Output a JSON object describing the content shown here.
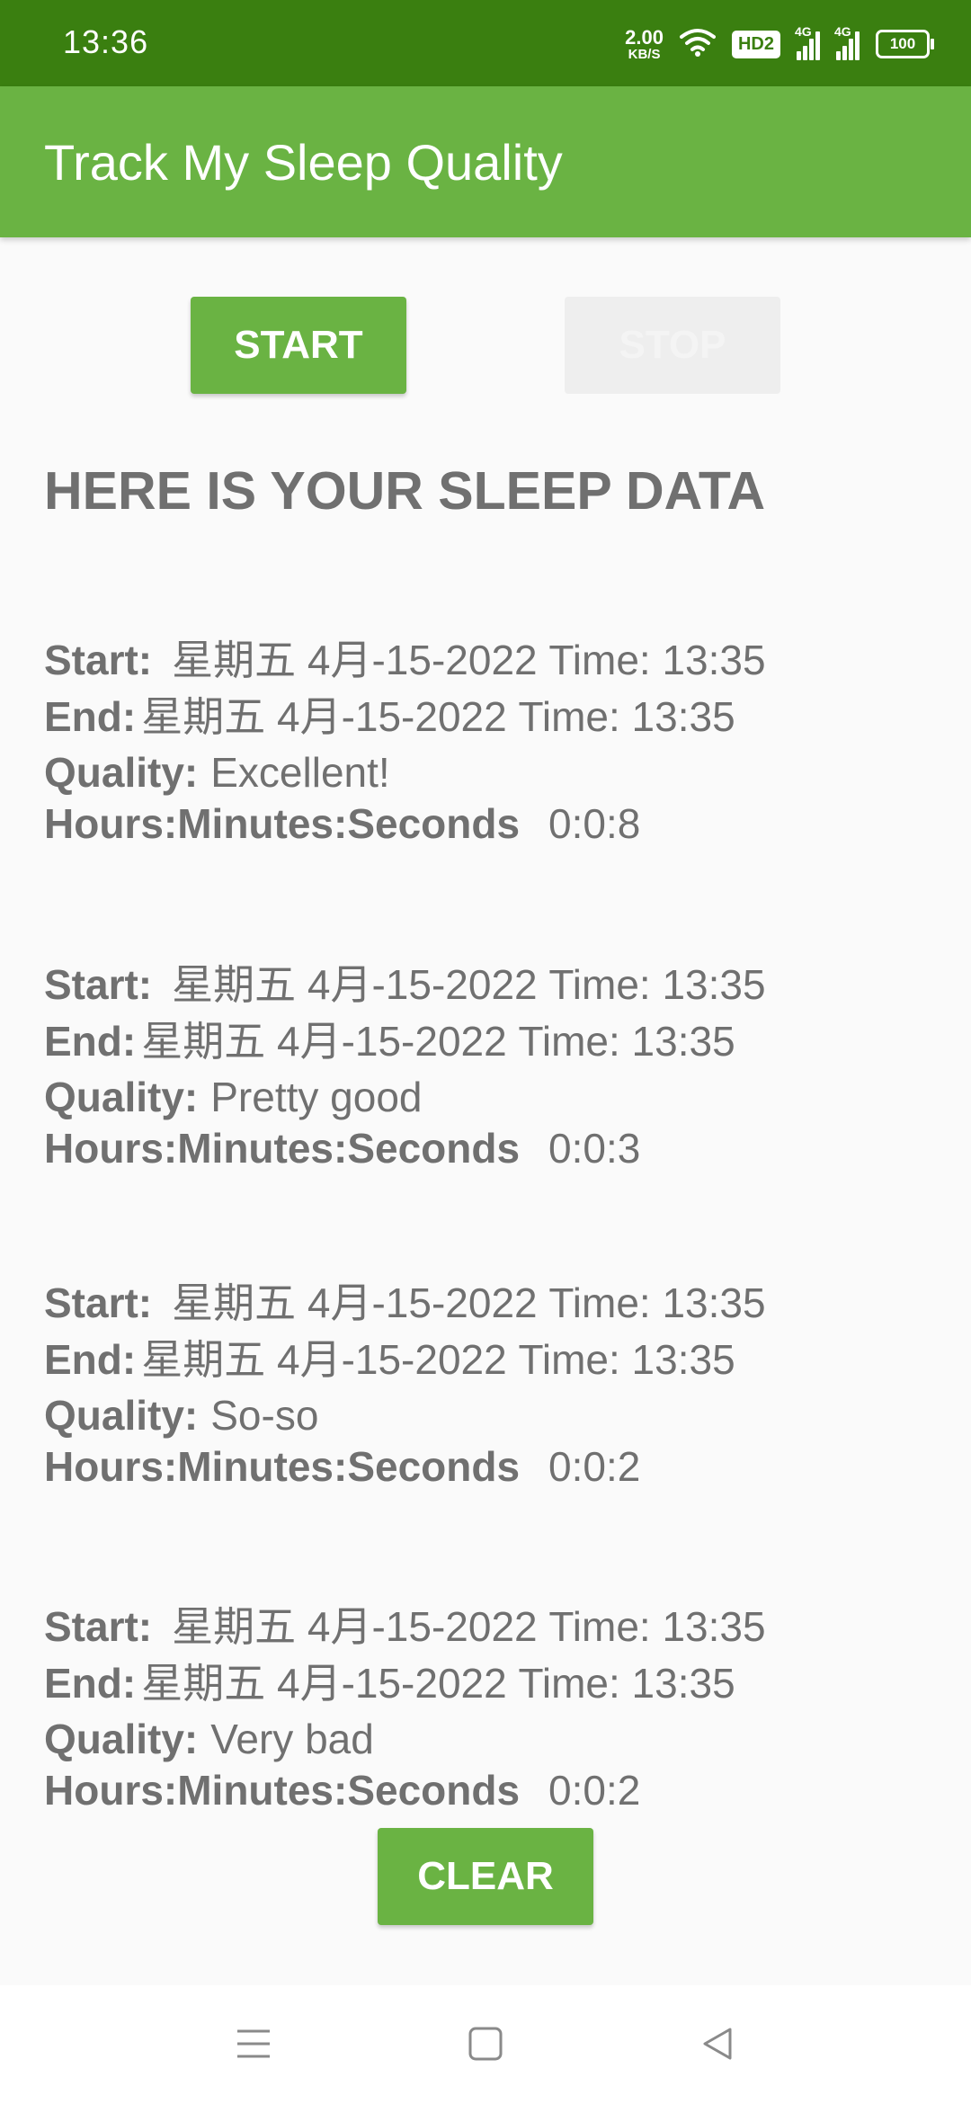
{
  "status_bar": {
    "time": "13:36",
    "net_speed_value": "2.00",
    "net_speed_unit": "KB/S",
    "hd_badge": "HD2",
    "sim1_label": "4G",
    "sim2_label": "4G",
    "battery": "100",
    "icons": [
      "wifi-icon",
      "hd-icon",
      "signal-icon",
      "signal-icon",
      "battery-icon"
    ]
  },
  "app_bar": {
    "title": "Track My Sleep Quality"
  },
  "controls": {
    "start_label": "START",
    "stop_label": "STOP",
    "stop_enabled": false,
    "clear_label": "CLEAR"
  },
  "heading": "HERE IS YOUR SLEEP DATA",
  "labels": {
    "start": "Start:",
    "end": "End:",
    "quality": "Quality:",
    "duration": "Hours:Minutes:Seconds"
  },
  "entries": [
    {
      "start": "星期五 4月-15-2022 Time: 13:35",
      "end": "星期五 4月-15-2022 Time: 13:35",
      "quality": "Excellent!",
      "duration": "0:0:8"
    },
    {
      "start": "星期五 4月-15-2022 Time: 13:35",
      "end": "星期五 4月-15-2022 Time: 13:35",
      "quality": "Pretty good",
      "duration": "0:0:3"
    },
    {
      "start": "星期五 4月-15-2022 Time: 13:35",
      "end": "星期五 4月-15-2022 Time: 13:35",
      "quality": "So-so",
      "duration": "0:0:2"
    },
    {
      "start": "星期五 4月-15-2022 Time: 13:35",
      "end": "星期五 4月-15-2022 Time: 13:35",
      "quality": "Very bad",
      "duration": "0:0:2"
    }
  ],
  "navigation": {
    "icons": [
      "menu-icon",
      "home-icon",
      "back-icon"
    ]
  },
  "colors": {
    "status_bar": "#3A7F10",
    "app_bar": "#6AB343",
    "accent_button": "#6AB343",
    "disabled_button": "#EEEEEE",
    "text": "#707070",
    "background": "#FAFAFA"
  }
}
